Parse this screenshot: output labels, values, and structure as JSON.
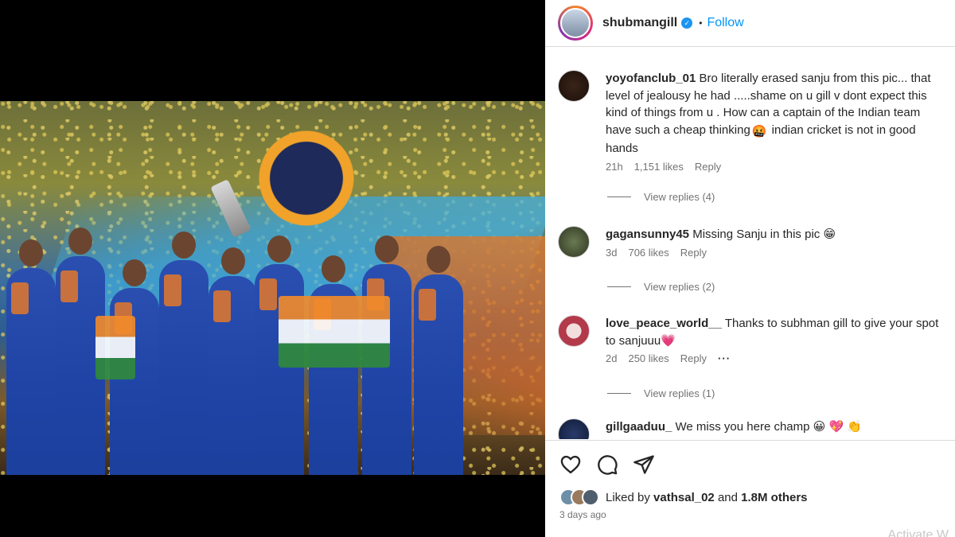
{
  "header": {
    "username": "shubmangill",
    "verified": true,
    "separator": "•",
    "follow_label": "Follow"
  },
  "comments": [
    {
      "username": "yoyofanclub_01",
      "text": "Bro literally erased sanju from this pic... that level of jealousy he had .....shame on u gill v dont expect this kind of things from u . How can a captain of the Indian team have such a cheap thinking",
      "emoji": "🤬",
      "text_after": "indian cricket is not in good hands",
      "time": "21h",
      "likes": "1,151 likes",
      "reply_label": "Reply",
      "view_replies": "View replies (4)"
    },
    {
      "username": "gagansunny45",
      "text": "Missing Sanju in this pic",
      "emoji": "😁",
      "time": "3d",
      "likes": "706 likes",
      "reply_label": "Reply",
      "view_replies": "View replies (2)"
    },
    {
      "username": "love_peace_world__",
      "text": "Thanks to subhman gill to give your spot to sanjuuu",
      "emoji": "💗",
      "time": "2d",
      "likes": "250 likes",
      "reply_label": "Reply",
      "more": "···",
      "view_replies": "View replies (1)"
    },
    {
      "username": "gillgaaduu_",
      "text": "We miss you here champ",
      "emojis": [
        "😀",
        "💖",
        "👏"
      ]
    }
  ],
  "actions": {
    "icons": [
      "heart-icon",
      "comment-icon",
      "share-icon"
    ]
  },
  "likes": {
    "prefix": "Liked by",
    "user": "vathsal_02",
    "middle": "and",
    "count": "1.8M others"
  },
  "post_time": "3 days ago",
  "watermark": "Activate W",
  "colors": {
    "accent": "#0095f6",
    "verified": "#1b95f0",
    "heart_emoji": "#e8375a"
  }
}
